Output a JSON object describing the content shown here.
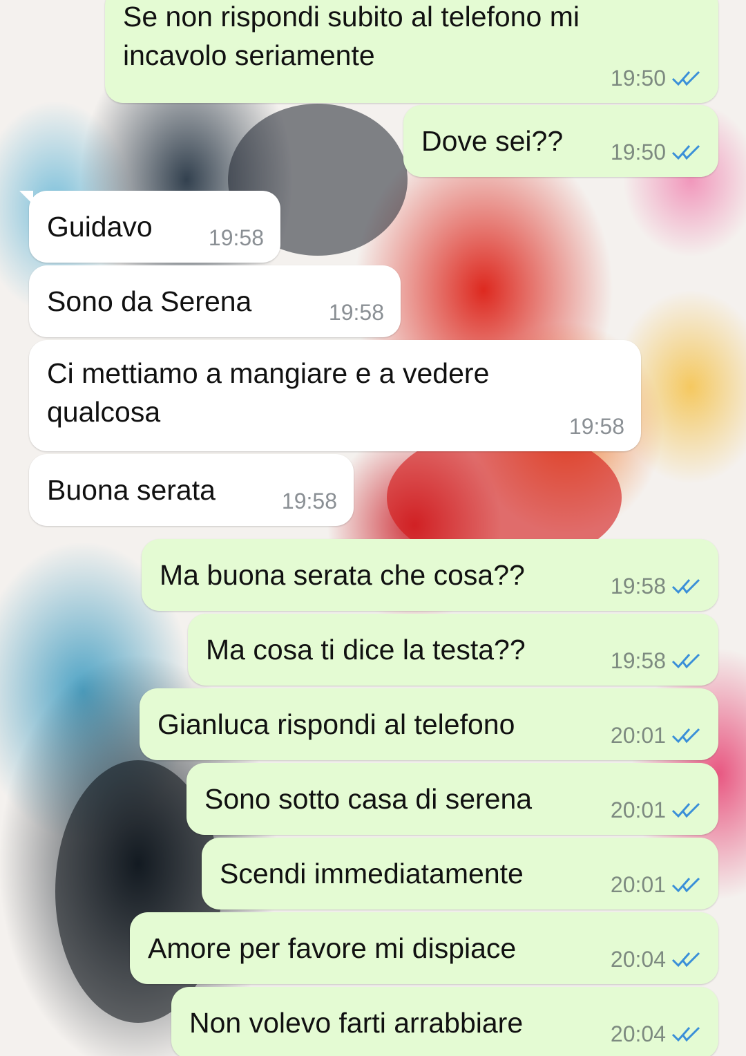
{
  "colors": {
    "outgoing_bubble": "#e4fbd3",
    "incoming_bubble": "#ffffff",
    "read_ticks": "#3a8fd8",
    "timestamp": "#7d8a80"
  },
  "messages": [
    {
      "direction": "out",
      "text": "Se non rispondi subito al telefono mi incavolo seriamente",
      "time": "19:50",
      "status_icon": "double-check-read-icon"
    },
    {
      "direction": "out",
      "text": "Dove sei??",
      "time": "19:50",
      "status_icon": "double-check-read-icon"
    },
    {
      "direction": "in",
      "text": "Guidavo",
      "time": "19:58"
    },
    {
      "direction": "in",
      "text": "Sono da Serena",
      "time": "19:58"
    },
    {
      "direction": "in",
      "text": "Ci mettiamo a mangiare e a vedere qualcosa",
      "time": "19:58"
    },
    {
      "direction": "in",
      "text": "Buona serata",
      "time": "19:58"
    },
    {
      "direction": "out",
      "text": "Ma buona serata che cosa??",
      "time": "19:58",
      "status_icon": "double-check-read-icon"
    },
    {
      "direction": "out",
      "text": "Ma cosa ti dice la testa??",
      "time": "19:58",
      "status_icon": "double-check-read-icon"
    },
    {
      "direction": "out",
      "text": "Gianluca rispondi al telefono",
      "time": "20:01",
      "status_icon": "double-check-read-icon"
    },
    {
      "direction": "out",
      "text": "Sono sotto casa di serena",
      "time": "20:01",
      "status_icon": "double-check-read-icon"
    },
    {
      "direction": "out",
      "text": "Scendi immediatamente",
      "time": "20:01",
      "status_icon": "double-check-read-icon"
    },
    {
      "direction": "out",
      "text": "Amore per favore mi dispiace",
      "time": "20:04",
      "status_icon": "double-check-read-icon"
    },
    {
      "direction": "out",
      "text": "Non volevo farti arrabbiare",
      "time": "20:04",
      "status_icon": "double-check-read-icon"
    }
  ]
}
